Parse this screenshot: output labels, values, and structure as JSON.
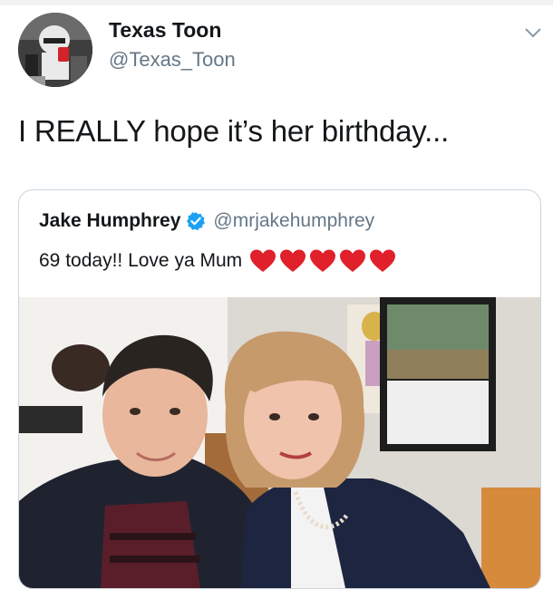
{
  "tweet": {
    "author_name": "Texas Toon",
    "author_handle": "@Texas_Toon",
    "text": "I REALLY hope it’s her birthday..."
  },
  "quoted_tweet": {
    "author_name": "Jake Humphrey",
    "author_handle": "@mrjakehumphrey",
    "text": "69 today!! Love ya Mum",
    "heart_count": 5,
    "verified": true
  },
  "icons": {
    "menu": "chevron-down-icon",
    "verified": "verified-badge-icon",
    "heart": "red-heart-emoji"
  },
  "colors": {
    "text_primary": "#14171a",
    "text_secondary": "#657786",
    "border": "#ccd6dd",
    "verified_blue": "#1da1f2",
    "heart_red": "#e0202a"
  }
}
